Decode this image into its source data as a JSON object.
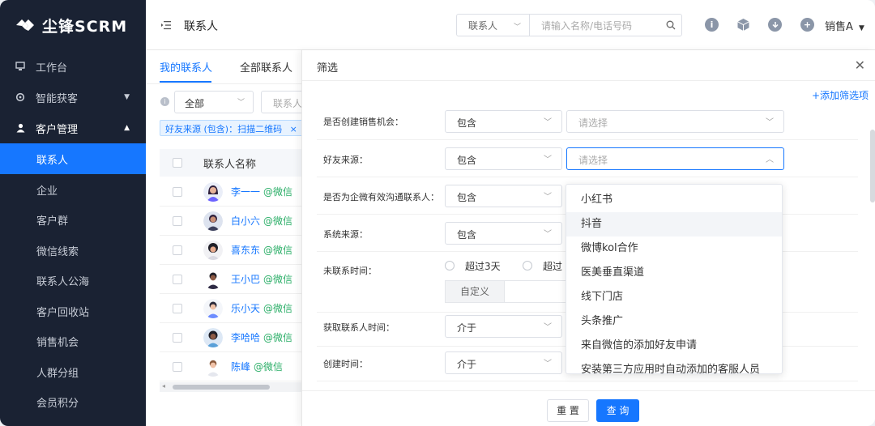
{
  "brand": {
    "name": "尘锋SCRM"
  },
  "sidebar": {
    "items": [
      {
        "label": "工作台",
        "icon": "monitor-icon"
      },
      {
        "label": "智能获客",
        "icon": "target-icon"
      },
      {
        "label": "客户管理",
        "icon": "users-icon"
      }
    ],
    "sub_items": [
      {
        "label": "联系人"
      },
      {
        "label": "企业"
      },
      {
        "label": "客户群"
      },
      {
        "label": "微信线索"
      },
      {
        "label": "联系人公海"
      },
      {
        "label": "客户回收站"
      },
      {
        "label": "销售机会"
      },
      {
        "label": "人群分组"
      },
      {
        "label": "会员积分"
      }
    ],
    "active": "联系人"
  },
  "header": {
    "title": "联系人",
    "search_type": "联系人",
    "search_placeholder": "请输入名称/电话号码",
    "user": "销售A"
  },
  "list": {
    "tabs": [
      "我的联系人",
      "全部联系人"
    ],
    "scope_select": "全部",
    "name_input": "联系人",
    "active_tag": "好友来源 (包含)：扫描二维码",
    "column_name": "联系人名称",
    "rows": [
      {
        "name": "李一一",
        "source": "@微信"
      },
      {
        "name": "白小六",
        "source": "@微信"
      },
      {
        "name": "喜东东",
        "source": "@微信"
      },
      {
        "name": "王小巴",
        "source": "@微信"
      },
      {
        "name": "乐小天",
        "source": "@微信"
      },
      {
        "name": "李哈哈",
        "source": "@微信"
      },
      {
        "name": "陈峰",
        "source": "@微信"
      }
    ]
  },
  "filter": {
    "title": "筛选",
    "add_filter": "+添加筛选项",
    "fields": [
      {
        "label": "是否创建销售机会：",
        "op": "包含",
        "placeholder": "请选择"
      },
      {
        "label": "好友来源：",
        "op": "包含",
        "placeholder": "请选择"
      },
      {
        "label": "是否为企微有效沟通联系人：",
        "op": "包含"
      },
      {
        "label": "系统来源：",
        "op": "包含"
      },
      {
        "label": "未联系时间："
      },
      {
        "label": "获取联系人时间：",
        "op": "介于"
      },
      {
        "label": "创建时间：",
        "op": "介于"
      }
    ],
    "radios": [
      "超过3天",
      "超过"
    ],
    "custom_label": "自定义",
    "reset_label": "重 置",
    "query_label": "查 询"
  },
  "dropdown": {
    "options": [
      "小红书",
      "抖音",
      "微博kol合作",
      "医美垂直渠道",
      "线下门店",
      "头条推广",
      "来自微信的添加好友申请",
      "安装第三方应用时自动添加的客服人员"
    ],
    "hovered": "抖音"
  },
  "colors": {
    "primary": "#1677ff",
    "sidebar_bg": "#1a2233",
    "wechat_green": "#2aae67"
  }
}
